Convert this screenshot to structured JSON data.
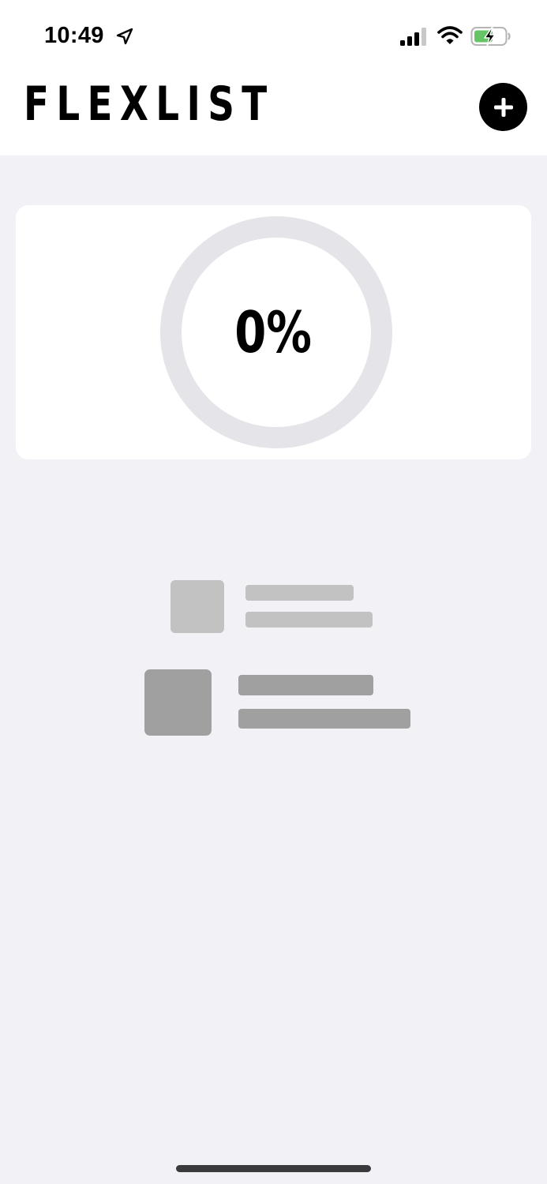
{
  "status_bar": {
    "time": "10:49",
    "icons": [
      "location-arrow-icon",
      "cellular-signal-icon",
      "wifi-icon",
      "battery-charging-icon"
    ],
    "battery_color": "#65c466"
  },
  "header": {
    "title": "FLEXLIST",
    "add_button_icon": "plus-icon"
  },
  "progress": {
    "label": "0%",
    "value": 0,
    "track_color": "#e4e4e9"
  },
  "empty_state": {
    "placeholder_items": 2,
    "colors": [
      "#c2c2c2",
      "#a0a0a0"
    ]
  },
  "colors": {
    "background": "#f1f1f6",
    "card": "#ffffff",
    "accent": "#000000"
  }
}
